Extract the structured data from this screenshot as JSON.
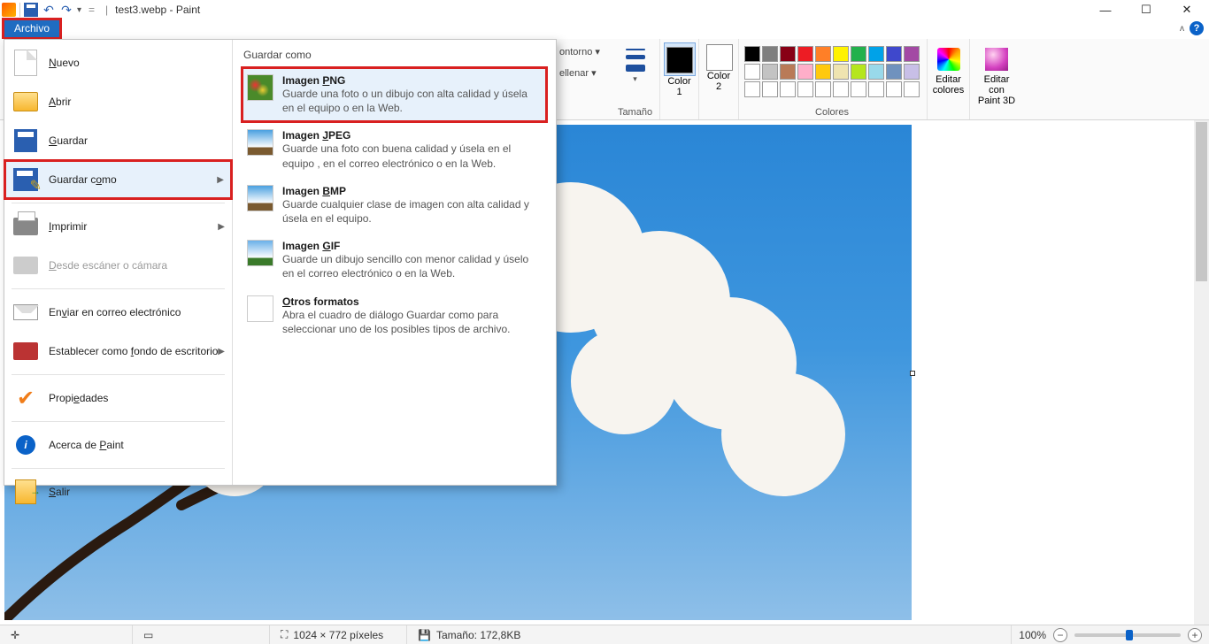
{
  "title": "test3.webp - Paint",
  "file_tab": "Archivo",
  "ribbon_peek": {
    "outline": "ontorno ▾",
    "fill": "ellenar ▾"
  },
  "ribbon": {
    "size": "Tamaño",
    "color1": "Color\n1",
    "color2": "Color\n2",
    "edit_colors": "Editar\ncolores",
    "colors_group": "Colores",
    "paint3d": "Editar con\nPaint 3D"
  },
  "palette_row1": [
    "#000000",
    "#7f7f7f",
    "#880015",
    "#ed1c24",
    "#ff7f27",
    "#fff200",
    "#22b14c",
    "#00a2e8",
    "#3f48cc",
    "#a349a4"
  ],
  "palette_row2": [
    "#ffffff",
    "#c3c3c3",
    "#b97a57",
    "#ffaec9",
    "#ffc90e",
    "#efe4b0",
    "#b5e61d",
    "#99d9ea",
    "#7092be",
    "#c8bfe7"
  ],
  "palette_row3": [
    "#ffffff",
    "#ffffff",
    "#ffffff",
    "#ffffff",
    "#ffffff",
    "#ffffff",
    "#ffffff",
    "#ffffff",
    "#ffffff",
    "#ffffff"
  ],
  "color1_value": "#000000",
  "color2_value": "#ffffff",
  "file_menu": {
    "new": "Nuevo",
    "open": "Abrir",
    "save": "Guardar",
    "save_as": "Guardar como",
    "print": "Imprimir",
    "scanner": "Desde escáner o cámara",
    "email": "Enviar en correo electrónico",
    "wallpaper": "Establecer como fondo de escritorio",
    "properties": "Propiedades",
    "about": "Acerca de Paint",
    "exit": "Salir"
  },
  "save_as_panel": {
    "title": "Guardar como",
    "png": {
      "t": "Imagen PNG",
      "d": "Guarde una foto o un dibujo con alta calidad y úsela en el equipo o en la Web."
    },
    "jpg": {
      "t": "Imagen JPEG",
      "d": "Guarde una foto con buena calidad y úsela en el equipo , en el correo electrónico o en la Web."
    },
    "bmp": {
      "t": "Imagen BMP",
      "d": "Guarde cualquier clase de imagen con alta calidad y úsela en el equipo."
    },
    "gif": {
      "t": "Imagen GIF",
      "d": "Guarde un dibujo sencillo con menor calidad y úselo en el correo electrónico o en la Web."
    },
    "other": {
      "t": "Otros formatos",
      "d": "Abra el cuadro de diálogo Guardar como para seleccionar uno de los posibles tipos de archivo."
    }
  },
  "status": {
    "dims": "1024 × 772 píxeles",
    "size": "Tamaño: 172,8KB",
    "zoom": "100%"
  }
}
